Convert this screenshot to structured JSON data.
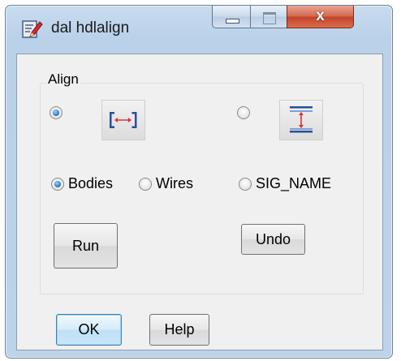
{
  "window": {
    "title": "dal hdlalign",
    "close_glyph": "x",
    "colors": {
      "frame": "#b9d1e9",
      "close": "#c2432a",
      "radio_checked": "#1f6fc4"
    }
  },
  "align_group": {
    "label": "Align",
    "options": [
      {
        "icon": "align-horizontal-icon",
        "checked": true
      },
      {
        "icon": "align-vertical-icon",
        "checked": false
      }
    ]
  },
  "target_options": [
    {
      "label": "Bodies",
      "checked": true
    },
    {
      "label": "Wires",
      "checked": false
    },
    {
      "label": "SIG_NAME",
      "checked": false
    }
  ],
  "buttons": {
    "run": "Run",
    "undo": "Undo",
    "ok": "OK",
    "help": "Help"
  }
}
